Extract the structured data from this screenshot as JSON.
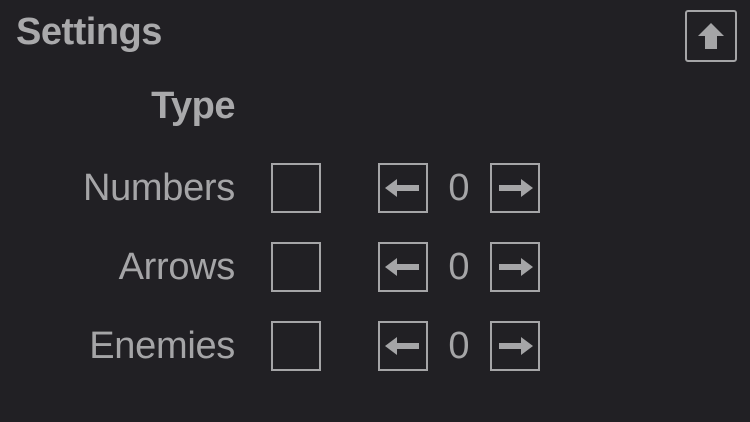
{
  "header": {
    "title": "Settings",
    "up_button_icon": "up-arrow-icon"
  },
  "section": {
    "heading": "Type"
  },
  "rows": [
    {
      "label": "Numbers",
      "checked": false,
      "value": "0"
    },
    {
      "label": "Arrows",
      "checked": false,
      "value": "0"
    },
    {
      "label": "Enemies",
      "checked": false,
      "value": "0"
    }
  ],
  "icons": {
    "decrease": "left-arrow-icon",
    "increase": "right-arrow-icon"
  },
  "colors": {
    "background": "#212024",
    "foreground": "#a5a5a7"
  }
}
